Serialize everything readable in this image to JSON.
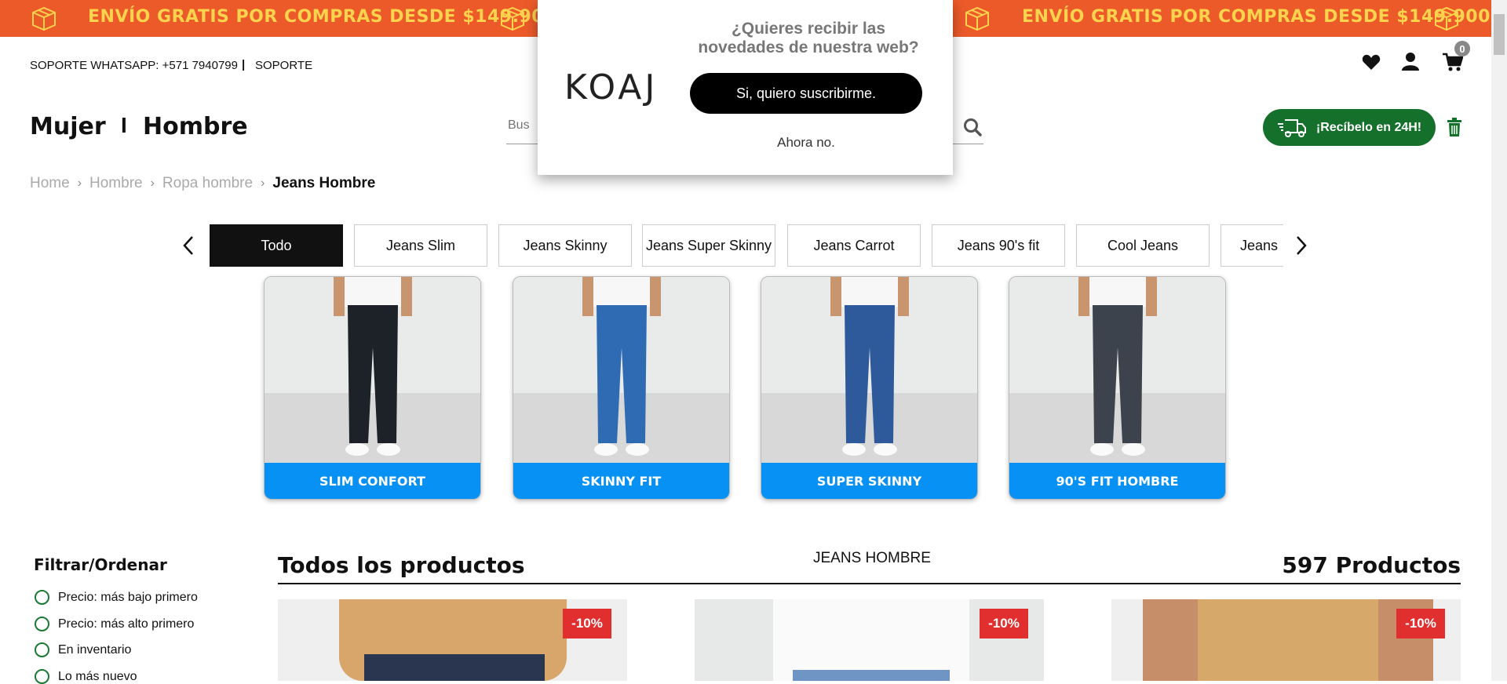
{
  "promo": {
    "text_left": "ENVÍO GRATIS POR COMPRAS DESDE $149.900",
    "text_right": "ENVÍO GRATIS POR COMPRAS DESDE $149.900",
    "bg_color": "#ec5a2a",
    "text_color": "#fcd34d"
  },
  "header": {
    "support_whatsapp": "SOPORTE WHATSAPP: +571 7940799",
    "separator": "|",
    "support": "SOPORTE",
    "cart_count": "0",
    "nav_women": "Mujer",
    "nav_sep": "I",
    "nav_men": "Hombre",
    "search_placeholder": "Bus",
    "recibelo": "¡Recíbelo en 24H!"
  },
  "breadcrumb": [
    "Home",
    "Hombre",
    "Ropa hombre",
    "Jeans Hombre"
  ],
  "tabs": [
    "Todo",
    "Jeans Slim",
    "Jeans Skinny",
    "Jeans Super Skinny",
    "Jeans Carrot",
    "Jeans 90's fit",
    "Cool Jeans",
    "Jeans"
  ],
  "categories": [
    {
      "label": "SLIM CONFORT",
      "jean_color": "#1c2228"
    },
    {
      "label": "SKINNY FIT",
      "jean_color": "#2f6bb3"
    },
    {
      "label": "SUPER SKINNY",
      "jean_color": "#2e5a9c"
    },
    {
      "label": "90'S FIT HOMBRE",
      "jean_color": "#3d434c"
    }
  ],
  "filter": {
    "title": "Filtrar/Ordenar",
    "options": [
      "Precio: más bajo primero",
      "Precio: más alto primero",
      "En inventario",
      "Lo más nuevo"
    ]
  },
  "products_section": {
    "title": "Todos los productos",
    "center_label": "JEANS HOMBRE",
    "count": "597 Productos",
    "badges": [
      "-10%",
      "-10%",
      "-10%"
    ]
  },
  "modal": {
    "logo": "KOAJ",
    "title": "¿Quieres recibir las novedades de nuestra web?",
    "subscribe": "Si, quiero suscribirme.",
    "dismiss": "Ahora no."
  },
  "colors": {
    "accent_green": "#14702a",
    "category_blue": "#0891f5",
    "discount_red": "#e12f2f"
  }
}
